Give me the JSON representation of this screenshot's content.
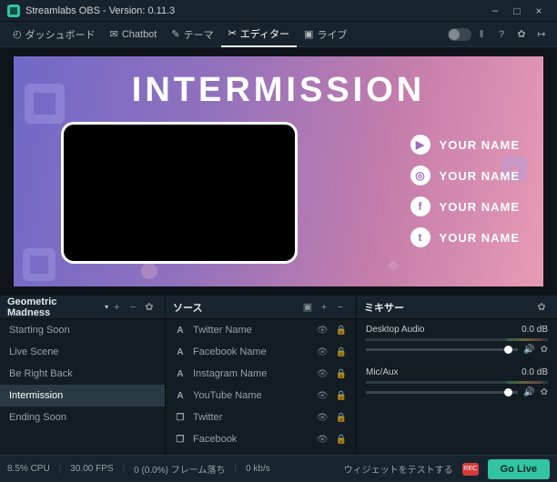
{
  "titlebar": {
    "title": "Streamlabs OBS - Version: 0.11.3"
  },
  "toolbar": {
    "tabs": [
      {
        "label": "ダッシュボード",
        "icon": "dashboard-icon"
      },
      {
        "label": "Chatbot",
        "icon": "chatbot-icon"
      },
      {
        "label": "テーマ",
        "icon": "theme-icon"
      },
      {
        "label": "エディター",
        "icon": "editor-icon",
        "active": true
      },
      {
        "label": "ライブ",
        "icon": "live-icon"
      }
    ]
  },
  "preview": {
    "heading": "INTERMISSION",
    "socials": [
      {
        "icon": "youtube-icon",
        "text": "YOUR NAME"
      },
      {
        "icon": "instagram-icon",
        "text": "YOUR NAME"
      },
      {
        "icon": "facebook-icon",
        "text": "YOUR NAME"
      },
      {
        "icon": "twitter-icon",
        "text": "YOUR NAME"
      }
    ]
  },
  "scenes": {
    "title": "Geometric Madness",
    "items": [
      {
        "label": "Starting Soon"
      },
      {
        "label": "Live Scene"
      },
      {
        "label": "Be Right Back"
      },
      {
        "label": "Intermission",
        "active": true
      },
      {
        "label": "Ending Soon"
      }
    ]
  },
  "sources": {
    "title": "ソース",
    "items": [
      {
        "icon": "A",
        "label": "Twitter Name"
      },
      {
        "icon": "A",
        "label": "Facebook Name"
      },
      {
        "icon": "A",
        "label": "Instagram Name"
      },
      {
        "icon": "A",
        "label": "YouTube Name"
      },
      {
        "icon": "❐",
        "label": "Twitter"
      },
      {
        "icon": "❐",
        "label": "Facebook"
      }
    ]
  },
  "mixer": {
    "title": "ミキサー",
    "channels": [
      {
        "name": "Desktop Audio",
        "level": "0.0 dB"
      },
      {
        "name": "Mic/Aux",
        "level": "0.0 dB"
      }
    ]
  },
  "statusbar": {
    "cpu": "8.5% CPU",
    "fps": "30.00 FPS",
    "dropped": "0 (0.0%) フレーム落ち",
    "bitrate": "0 kb/s",
    "test_label": "ウィジェットをテストする",
    "golive": "Go Live"
  }
}
